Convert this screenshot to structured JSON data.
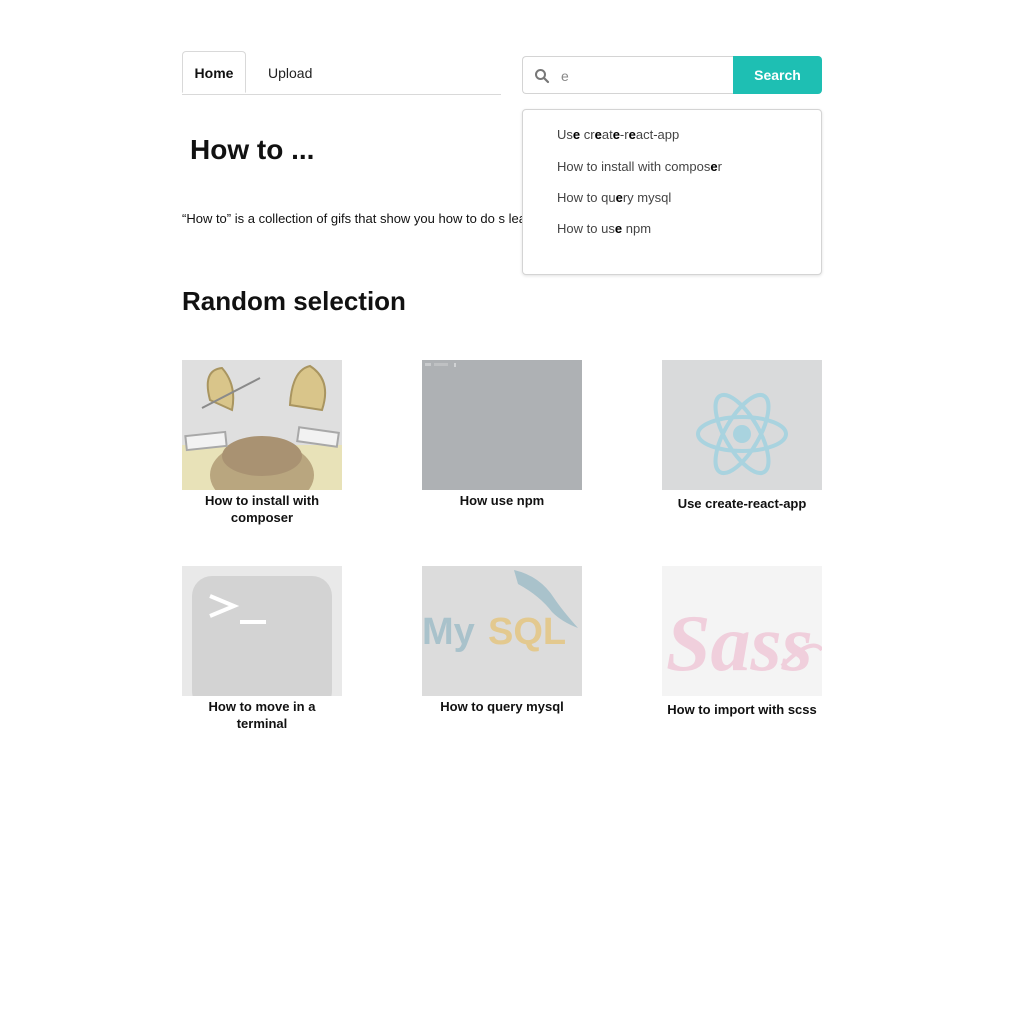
{
  "nav": {
    "tabs": [
      {
        "label": "Home",
        "active": true
      },
      {
        "label": "Upload",
        "active": false
      }
    ]
  },
  "search": {
    "value": "e",
    "button_label": "Search",
    "icon": "search-icon",
    "suggestions": [
      {
        "text": "Use create-react-app",
        "highlighted_letter": "e"
      },
      {
        "text": "How to install with composer",
        "highlighted_letter": "e"
      },
      {
        "text": "How to query mysql",
        "highlighted_letter": "e"
      },
      {
        "text": "How to use npm",
        "highlighted_letter": "e"
      }
    ]
  },
  "hero": {
    "title": "How to ...",
    "description": "“How to” is a collection of gifs that show you how to do s learning is by seing someone do it."
  },
  "random": {
    "title": "Random selection",
    "cards": [
      {
        "title": "How to install with composer",
        "image": "composer-logo"
      },
      {
        "title": "How use npm",
        "image": "terminal-screenshot"
      },
      {
        "title": "Use create-react-app",
        "image": "react-logo"
      },
      {
        "title": "How to move in a terminal",
        "image": "terminal-icon"
      },
      {
        "title": "How to query mysql",
        "image": "mysql-logo"
      },
      {
        "title": "How to import with scss",
        "image": "sass-logo"
      }
    ]
  },
  "colors": {
    "accent": "#1ebfb3",
    "border": "#d4d4d4"
  }
}
